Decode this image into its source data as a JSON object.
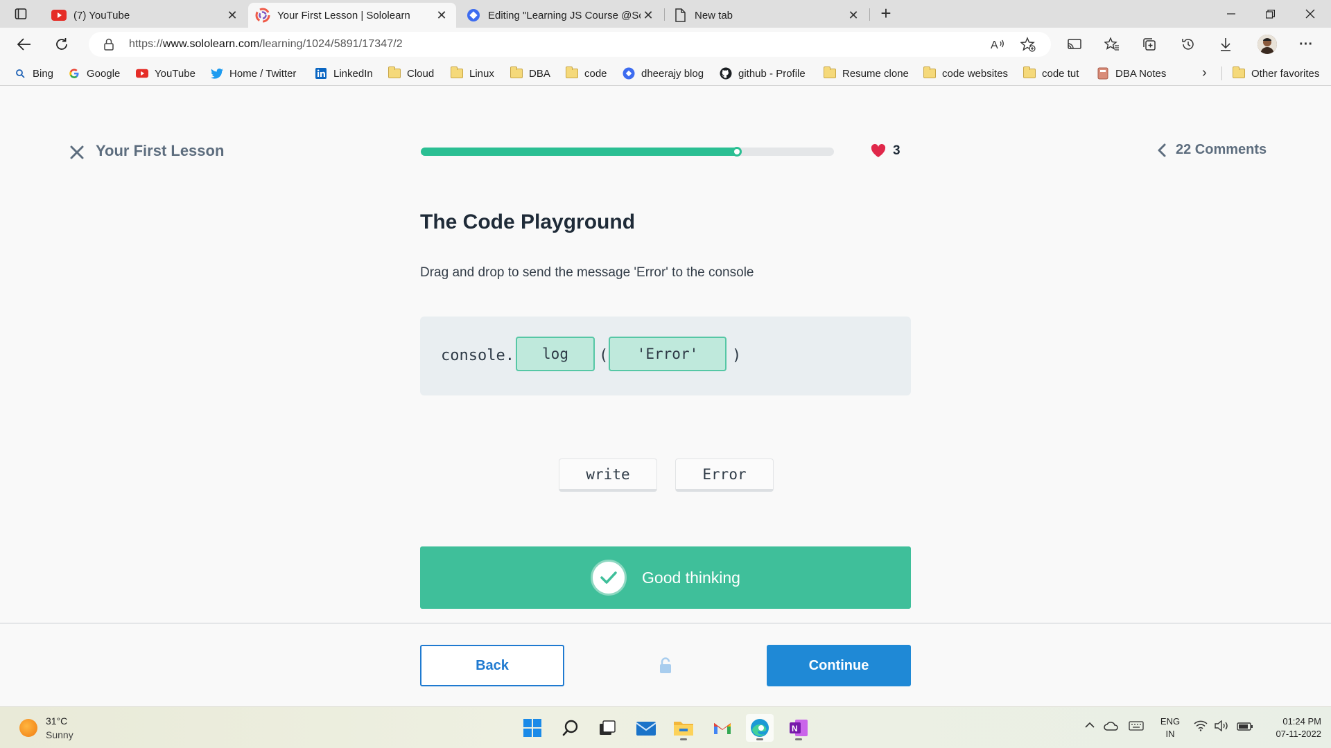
{
  "browser": {
    "tabs": [
      {
        "title": "(7) YouTube",
        "icon": "youtube-icon"
      },
      {
        "title": "Your First Lesson | Sololearn",
        "icon": "sololearn-icon"
      },
      {
        "title": "Editing \"Learning JS Course @So",
        "icon": "editor-icon"
      },
      {
        "title": "New tab",
        "icon": "page-icon"
      }
    ],
    "active_tab": 1,
    "url_prefix": "https://",
    "url_domain": "www.sololearn.com",
    "url_path": "/learning/1024/5891/17347/2",
    "bookmarks": [
      {
        "label": "Bing",
        "icon": "search-icon"
      },
      {
        "label": "Google",
        "icon": "google-icon"
      },
      {
        "label": "YouTube",
        "icon": "youtube-icon"
      },
      {
        "label": "Home / Twitter",
        "icon": "twitter-icon"
      },
      {
        "label": "LinkedIn",
        "icon": "linkedin-icon"
      },
      {
        "label": "Cloud",
        "icon": "folder-icon"
      },
      {
        "label": "Linux",
        "icon": "folder-icon"
      },
      {
        "label": "DBA",
        "icon": "folder-icon"
      },
      {
        "label": "code",
        "icon": "folder-icon"
      },
      {
        "label": "dheerajy blog",
        "icon": "blog-icon"
      },
      {
        "label": "github - Profile",
        "icon": "github-icon"
      },
      {
        "label": "Resume clone",
        "icon": "folder-icon"
      },
      {
        "label": "code websites",
        "icon": "folder-icon"
      },
      {
        "label": "code tut",
        "icon": "folder-icon"
      },
      {
        "label": "DBA Notes",
        "icon": "notes-icon"
      }
    ],
    "other_favorites": "Other favorites"
  },
  "lesson": {
    "title": "Your First Lesson",
    "progress": 0.77,
    "hearts": "3",
    "comments": "22 Comments"
  },
  "question": {
    "title": "The Code Playground",
    "description": "Drag and drop to send the message 'Error' to the console",
    "code_prefix": "console.",
    "slot1": "log",
    "paren_open": "(",
    "slot2": "'Error'",
    "paren_close": ")",
    "options": [
      "write",
      "Error"
    ]
  },
  "feedback": {
    "text": "Good thinking",
    "color": "#3fbf9a"
  },
  "footer": {
    "back": "Back",
    "continue": "Continue"
  },
  "taskbar": {
    "temperature": "31°C",
    "condition": "Sunny",
    "language": "ENG",
    "region": "IN",
    "time": "01:24 PM",
    "date": "07-11-2022"
  },
  "colors": {
    "accent_green": "#2bbf93",
    "primary_blue": "#1f89d6",
    "heart": "#e0284a"
  }
}
